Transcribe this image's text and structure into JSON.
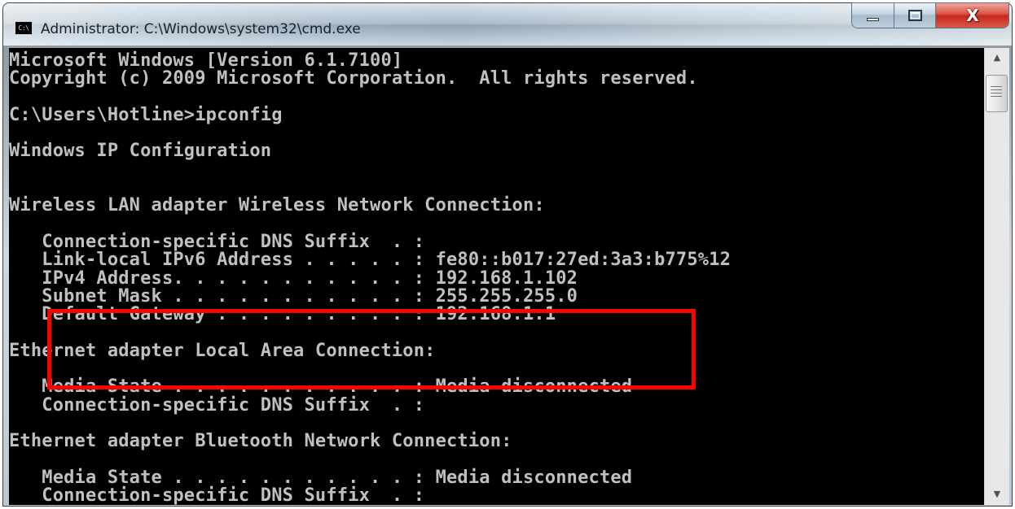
{
  "window": {
    "title": "Administrator: C:\\Windows\\system32\\cmd.exe",
    "icon_text": "C:\\"
  },
  "controls": {
    "minimize_icon": "minimize-icon",
    "maximize_icon": "maximize-icon",
    "close_icon": "close-icon",
    "close_glyph": "X"
  },
  "console": {
    "lines": [
      "Microsoft Windows [Version 6.1.7100]",
      "Copyright (c) 2009 Microsoft Corporation.  All rights reserved.",
      "",
      "C:\\Users\\Hotline>ipconfig",
      "",
      "Windows IP Configuration",
      "",
      "",
      "Wireless LAN adapter Wireless Network Connection:",
      "",
      "   Connection-specific DNS Suffix  . :",
      "   Link-local IPv6 Address . . . . . : fe80::b017:27ed:3a3:b775%12",
      "   IPv4 Address. . . . . . . . . . . : 192.168.1.102",
      "   Subnet Mask . . . . . . . . . . . : 255.255.255.0",
      "   Default Gateway . . . . . . . . . : 192.168.1.1",
      "",
      "Ethernet adapter Local Area Connection:",
      "",
      "   Media State . . . . . . . . . . . : Media disconnected",
      "   Connection-specific DNS Suffix  . :",
      "",
      "Ethernet adapter Bluetooth Network Connection:",
      "",
      "   Media State . . . . . . . . . . . : Media disconnected",
      "   Connection-specific DNS Suffix  . :"
    ]
  },
  "scrollbar": {
    "up_glyph": "▲",
    "down_glyph": "▼",
    "position_percent": 0
  },
  "colors": {
    "console_background": "#000000",
    "console_text": "#c0c0c0",
    "highlight": "#ff0000",
    "close_button": "#c7281a"
  }
}
